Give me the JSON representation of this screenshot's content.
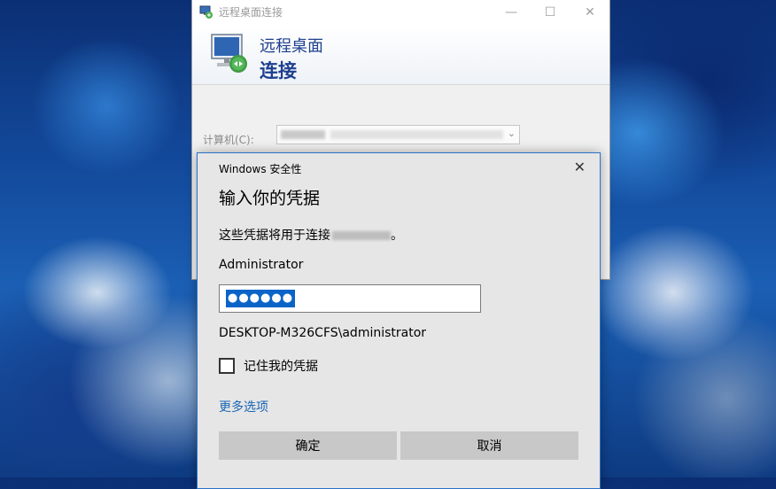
{
  "rdp": {
    "window_title": "远程桌面连接",
    "banner_line1": "远程桌面",
    "banner_line2": "连接",
    "computer_label": "计算机(C):",
    "controls": {
      "minimize": "—",
      "maximize": "☐",
      "close": "✕"
    }
  },
  "security": {
    "header": "Windows 安全性",
    "close": "✕",
    "title": "输入你的凭据",
    "description": "这些凭据将用于连接",
    "description_suffix": "。",
    "username": "Administrator",
    "password_masked": "●●●●●●",
    "domain_user": "DESKTOP-M326CFS\\administrator",
    "remember_label": "记住我的凭据",
    "remember_checked": false,
    "more_options": "更多选项",
    "ok_button": "确定",
    "cancel_button": "取消"
  },
  "colors": {
    "accent": "#0a64c8",
    "link": "#1a66b5",
    "banner_text": "#1e3f8f",
    "dialog_border": "#2a72c8"
  },
  "icons": [
    "remote-desktop-icon",
    "minimize-icon",
    "maximize-icon",
    "close-icon",
    "chevron-down-icon"
  ]
}
